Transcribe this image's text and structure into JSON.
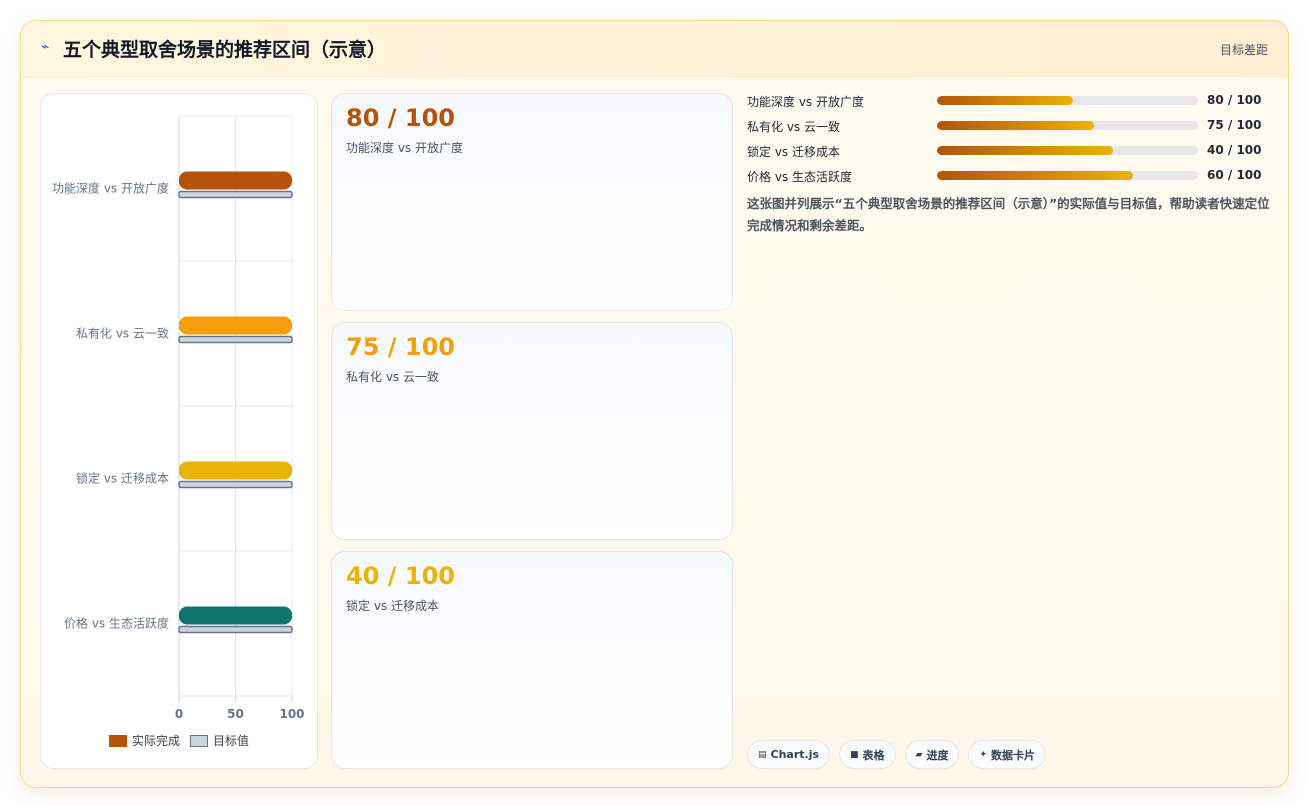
{
  "header": {
    "icon": "bolt-icon",
    "title": "五个典型取舍场景的推荐区间（示意）",
    "right_label": "目标差距"
  },
  "chart_data": {
    "type": "bar",
    "orientation": "horizontal",
    "categories": [
      "功能深度 vs 开放广度",
      "私有化 vs 云一致",
      "锁定 vs 迁移成本",
      "价格 vs 生态活跃度"
    ],
    "series": [
      {
        "name": "实际完成",
        "values": [
          100,
          100,
          100,
          100
        ],
        "colors": [
          "#b45309",
          "#f59e0b",
          "#eab308",
          "#0f766e"
        ]
      },
      {
        "name": "目标值",
        "values": [
          100,
          100,
          100,
          100
        ],
        "color": "#cbd5e1"
      }
    ],
    "x_ticks": [
      "0",
      "50",
      "100"
    ],
    "xlim": [
      0,
      100
    ],
    "grid": true,
    "legend_position": "bottom"
  },
  "metrics": [
    {
      "value": "80 / 100",
      "label": "功能深度 vs 开放广度",
      "color": "#b45309"
    },
    {
      "value": "75 / 100",
      "label": "私有化 vs 云一致",
      "color": "#f59e0b"
    },
    {
      "value": "40 / 100",
      "label": "锁定 vs 迁移成本",
      "color": "#eab308"
    }
  ],
  "progress": [
    {
      "label": "功能深度 vs 开放广度",
      "value": "80 / 100",
      "fraction": 0.52
    },
    {
      "label": "私有化 vs 云一致",
      "value": "75 / 100",
      "fraction": 0.6
    },
    {
      "label": "锁定 vs 迁移成本",
      "value": "40 / 100",
      "fraction": 0.675
    },
    {
      "label": "价格 vs 生态活跃度",
      "value": "60 / 100",
      "fraction": 0.75
    }
  ],
  "description": "这张图并列展示“五个典型取舍场景的推荐区间（示意）”的实际值与目标值，帮助读者快速定位完成情况和剩余差距。",
  "tags": [
    {
      "icon": "chart-icon",
      "glyph": "▤",
      "label": "Chart.js"
    },
    {
      "icon": "table-icon",
      "glyph": "■",
      "label": "表格"
    },
    {
      "icon": "progress-icon",
      "glyph": "▰",
      "label": "进度"
    },
    {
      "icon": "sparkle-icon",
      "glyph": "✦",
      "label": "数据卡片"
    }
  ]
}
